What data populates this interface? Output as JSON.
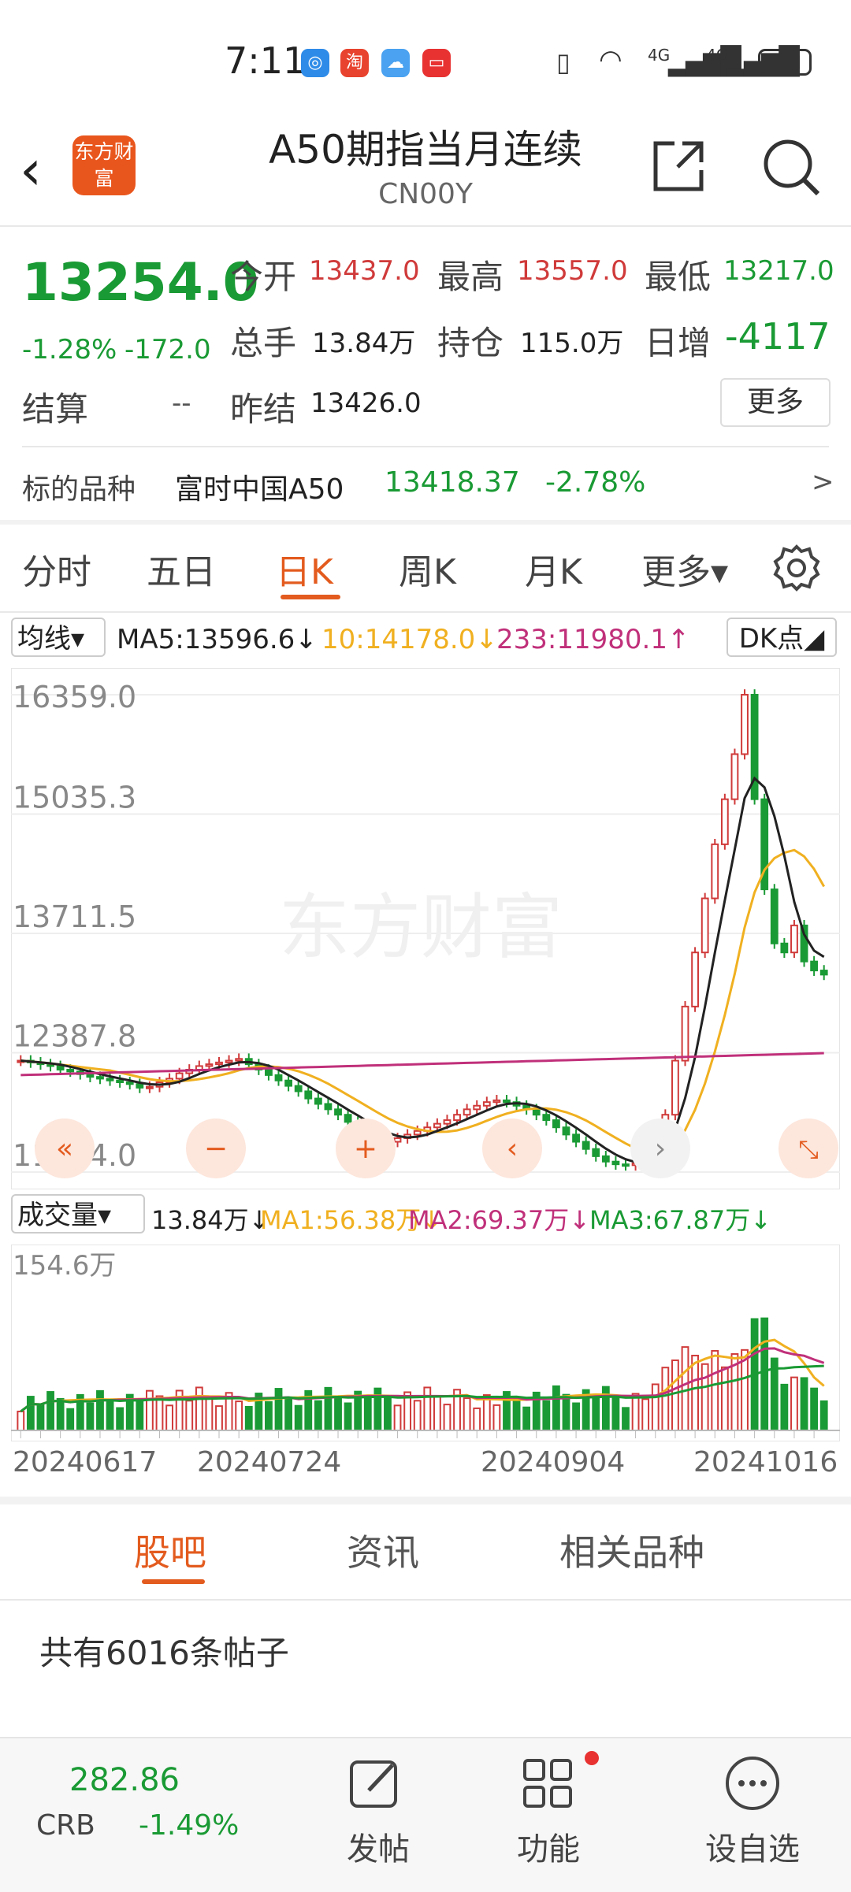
{
  "status_bar": {
    "time": "7:11",
    "signal_label_1": "4G",
    "signal_label_2": "4G"
  },
  "header": {
    "back_icon": "chevron-left-icon",
    "logo_text": "东方财富",
    "title": "A50期指当月连续",
    "code": "CN00Y",
    "share_icon": "share-icon",
    "search_icon": "search-icon"
  },
  "quote": {
    "price": "13254.0",
    "change_pct": "-1.28%",
    "change": "-172.0",
    "open_label": "今开",
    "open": "13437.0",
    "high_label": "最高",
    "high": "13557.0",
    "low_label": "最低",
    "low": "13217.0",
    "volume_label": "总手",
    "volume": "13.84万",
    "position_label": "持仓",
    "position": "115.0万",
    "daily_inc_label": "日增",
    "daily_inc": "-4117",
    "settle_label": "结算",
    "settle": "--",
    "prev_settle_label": "昨结",
    "prev_settle": "13426.0",
    "more_button": "更多"
  },
  "underlying": {
    "label": "标的品种",
    "name": "富时中国A50",
    "price": "13418.37",
    "change_pct": "-2.78%",
    "arrow": ">"
  },
  "period_tabs": [
    "分时",
    "五日",
    "日K",
    "周K",
    "月K",
    "更多▾"
  ],
  "period_active": "日K",
  "ma_row": {
    "selector": "均线▾",
    "ma5": "MA5:13596.6↓",
    "ma10": "10:14178.0↓",
    "ma233": "233:11980.1↑",
    "dk_button": "DK点◢"
  },
  "volume_row": {
    "selector": "成交量▾",
    "vol": "13.84万↓",
    "ma1": "MA1:56.38万↓",
    "ma2": "MA2:69.37万↓",
    "ma3": "MA3:67.87万↓"
  },
  "chart_data": {
    "type": "candlestick",
    "y_ticks": [
      "16359.0",
      "15035.3",
      "13711.5",
      "12387.8",
      "11064.0"
    ],
    "ylim": [
      11064.0,
      16359.0
    ],
    "volume_top_label": "154.6万",
    "x_ticks": [
      "20240617",
      "20240724",
      "20240904",
      "20241016"
    ],
    "watermark": "东方财富",
    "colors": {
      "up": "#d03a3a",
      "down": "#1a9a34",
      "ma5": "#222222",
      "ma10": "#f0b020",
      "ma233": "#c0307a"
    },
    "closes": [
      12300,
      12280,
      12260,
      12240,
      12200,
      12180,
      12150,
      12120,
      12100,
      12080,
      12060,
      12040,
      12000,
      12010,
      12060,
      12100,
      12160,
      12200,
      12240,
      12260,
      12280,
      12300,
      12320,
      12260,
      12200,
      12140,
      12080,
      12020,
      11960,
      11880,
      11820,
      11760,
      11700,
      11620,
      11560,
      11480,
      11440,
      11400,
      11440,
      11480,
      11520,
      11560,
      11600,
      11640,
      11700,
      11760,
      11800,
      11840,
      11860,
      11840,
      11800,
      11760,
      11700,
      11640,
      11560,
      11480,
      11400,
      11320,
      11240,
      11180,
      11150,
      11140,
      11160,
      11220,
      11300,
      11700,
      12300,
      12900,
      13500,
      14100,
      14700,
      15200,
      15700,
      16359,
      15200,
      14200,
      13600,
      13500,
      13800,
      13400,
      13300,
      13254
    ]
  },
  "bottom_tabs": [
    "股吧",
    "资讯",
    "相关品种"
  ],
  "bottom_active": "股吧",
  "post_count": "共有6016条帖子",
  "footer": {
    "index_value": "282.86",
    "index_name": "CRB",
    "index_change": "-1.49%",
    "post_label": "发帖",
    "func_label": "功能",
    "watch_label": "设自选"
  }
}
